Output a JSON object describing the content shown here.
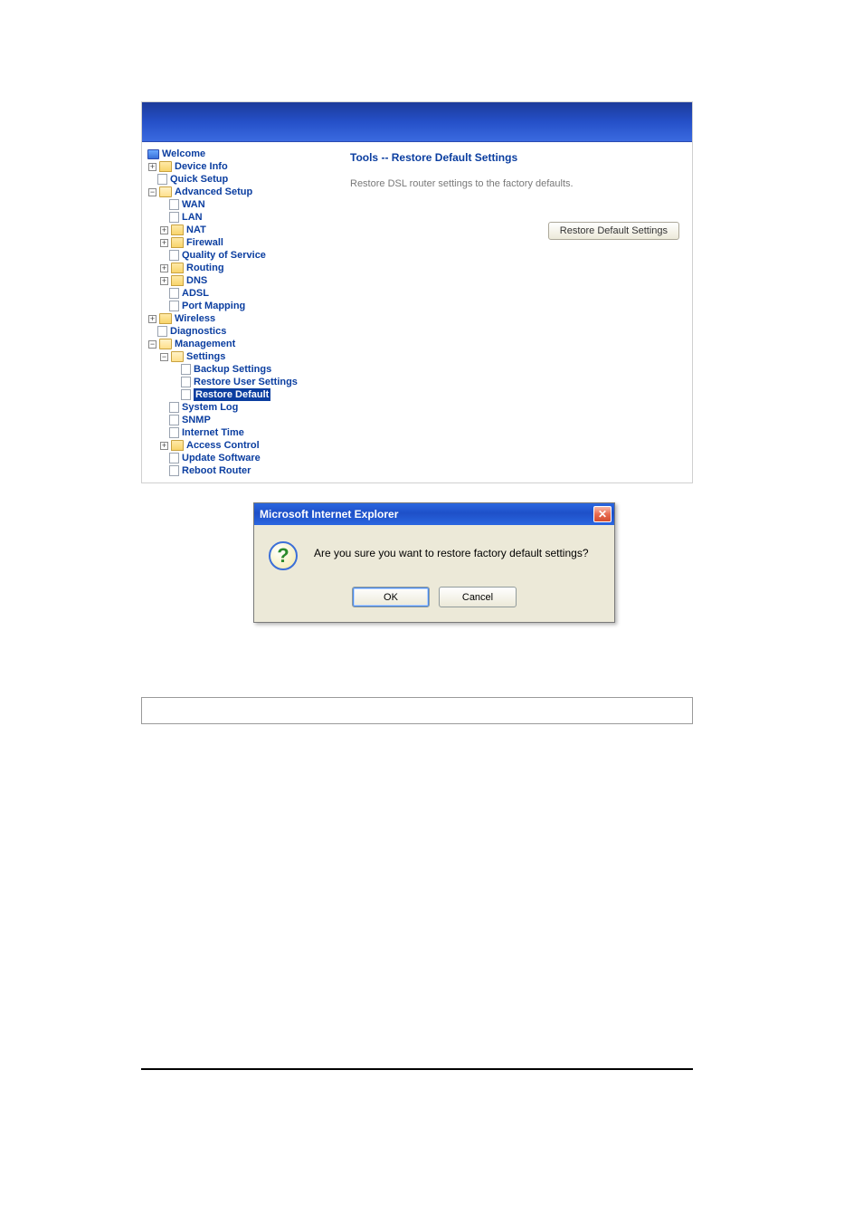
{
  "tree": {
    "root": {
      "label": "Welcome"
    },
    "device_info": {
      "label": "Device Info"
    },
    "quick_setup": {
      "label": "Quick Setup"
    },
    "advanced_setup": {
      "label": "Advanced Setup"
    },
    "wan": {
      "label": "WAN"
    },
    "lan": {
      "label": "LAN"
    },
    "nat": {
      "label": "NAT"
    },
    "firewall": {
      "label": "Firewall"
    },
    "qos": {
      "label": "Quality of Service"
    },
    "routing": {
      "label": "Routing"
    },
    "dns": {
      "label": "DNS"
    },
    "adsl": {
      "label": "ADSL"
    },
    "port_mapping": {
      "label": "Port Mapping"
    },
    "wireless": {
      "label": "Wireless"
    },
    "diagnostics": {
      "label": "Diagnostics"
    },
    "management": {
      "label": "Management"
    },
    "settings": {
      "label": "Settings"
    },
    "backup_settings": {
      "label": "Backup Settings"
    },
    "restore_user_settings": {
      "label": "Restore User Settings"
    },
    "restore_default": {
      "label": "Restore Default"
    },
    "system_log": {
      "label": "System Log"
    },
    "snmp": {
      "label": "SNMP"
    },
    "internet_time": {
      "label": "Internet Time"
    },
    "access_control": {
      "label": "Access Control"
    },
    "update_software": {
      "label": "Update Software"
    },
    "reboot_router": {
      "label": "Reboot Router"
    }
  },
  "content": {
    "title": "Tools -- Restore Default Settings",
    "text": "Restore DSL router settings to the factory defaults.",
    "restore_button": "Restore Default Settings"
  },
  "dialog": {
    "title": "Microsoft Internet Explorer",
    "message": "Are you sure you want to restore factory default settings?",
    "ok": "OK",
    "cancel": "Cancel",
    "close_glyph": "✕",
    "icon_glyph": "?"
  }
}
